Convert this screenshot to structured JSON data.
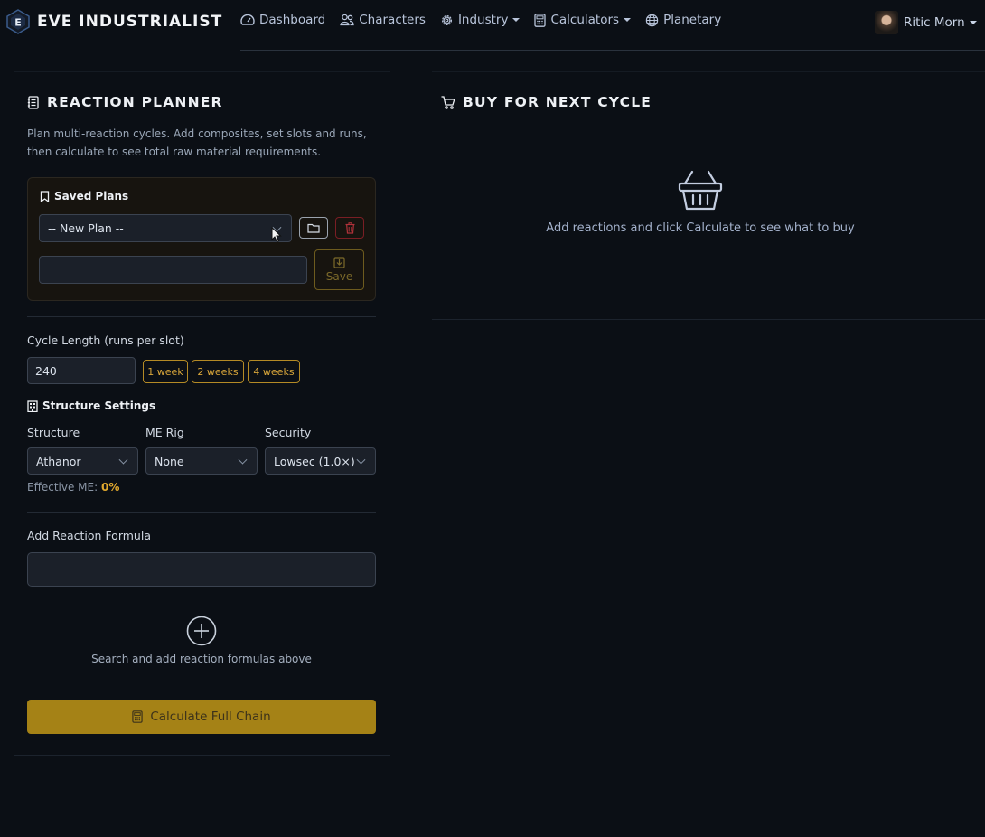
{
  "brand": {
    "logo_letter": "E",
    "name": "EVE INDUSTRIALIST"
  },
  "nav": {
    "items": [
      {
        "label": "Dashboard",
        "icon": "speedometer-icon",
        "dropdown": false
      },
      {
        "label": "Characters",
        "icon": "people-icon",
        "dropdown": false
      },
      {
        "label": "Industry",
        "icon": "gear-icon",
        "dropdown": true
      },
      {
        "label": "Calculators",
        "icon": "calculator-icon",
        "dropdown": true
      },
      {
        "label": "Planetary",
        "icon": "globe-icon",
        "dropdown": false
      }
    ],
    "user": "Ritic Morn"
  },
  "planner": {
    "title": "REACTION PLANNER",
    "description": "Plan multi-reaction cycles. Add composites, set slots and runs, then calculate to see total raw material requirements.",
    "saved_plans": {
      "title": "Saved Plans",
      "selected": "-- New Plan --",
      "name_value": "",
      "save_label": "Save"
    },
    "cycle": {
      "label": "Cycle Length (runs per slot)",
      "value": "240",
      "presets": [
        "1 week",
        "2 weeks",
        "4 weeks"
      ]
    },
    "structure": {
      "title": "Structure Settings",
      "structure_label": "Structure",
      "structure_value": "Athanor",
      "rig_label": "ME Rig",
      "rig_value": "None",
      "security_label": "Security",
      "security_value": "Lowsec (1.0×)",
      "effective_me_label": "Effective ME:",
      "effective_me_value": "0%"
    },
    "formula": {
      "label": "Add Reaction Formula",
      "value": "",
      "empty_hint": "Search and add reaction formulas above"
    },
    "calculate_label": "Calculate Full Chain"
  },
  "buy": {
    "title": "BUY FOR NEXT CYCLE",
    "empty_hint": "Add reactions and click Calculate to see what to buy"
  },
  "colors": {
    "accent": "#a58216",
    "pill": "#d9a63a",
    "danger": "#b1323a"
  }
}
